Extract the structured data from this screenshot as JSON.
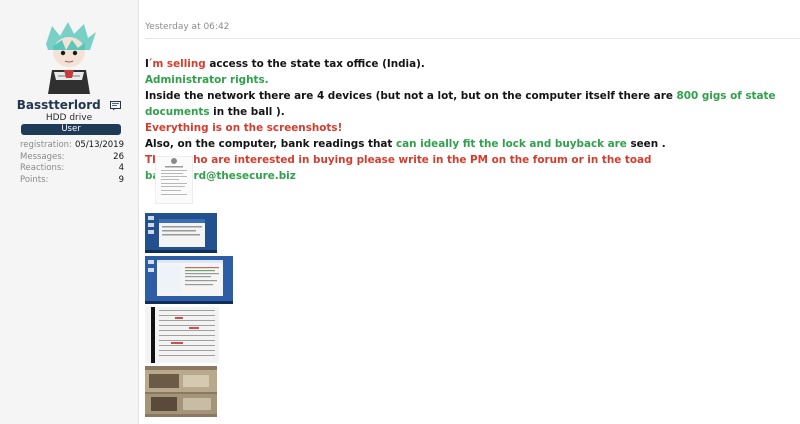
{
  "author": {
    "username": "Basstterlord",
    "title": "HDD drive",
    "badge": "User",
    "stats": [
      {
        "label": "registration:",
        "value": "05/13/2019"
      },
      {
        "label": "Messages:",
        "value": "26"
      },
      {
        "label": "Reactions:",
        "value": "4"
      },
      {
        "label": "Points:",
        "value": "9"
      }
    ]
  },
  "post": {
    "timestamp": "Yesterday at 06:42",
    "line1_a": "I",
    "line1_b": " ́m selling",
    "line1_c": " access to the state tax office (India).",
    "line2": "Administrator rights.",
    "line3_a": "Inside the network there are 4 devices (but not a lot, but on the computer itself there are ",
    "line3_b": "800 gigs of state documents",
    "line3_c": " in the ball ).",
    "line4": "Everything is on the screenshots!",
    "line5_a": "Also, on the computer, bank readings that ",
    "line5_b": "can ideally fit the lock and buyback are",
    "line5_c": " seen .",
    "line6_a": "Those who are interested in buying please write in the PM on the forum or in the toad ",
    "line6_b": "basterlord@thesecure.biz"
  },
  "colors": {
    "red": "#d63c2d",
    "green": "#2fa14a",
    "badge_bg": "#1f3a56"
  },
  "icons": {
    "message": "message-icon"
  }
}
